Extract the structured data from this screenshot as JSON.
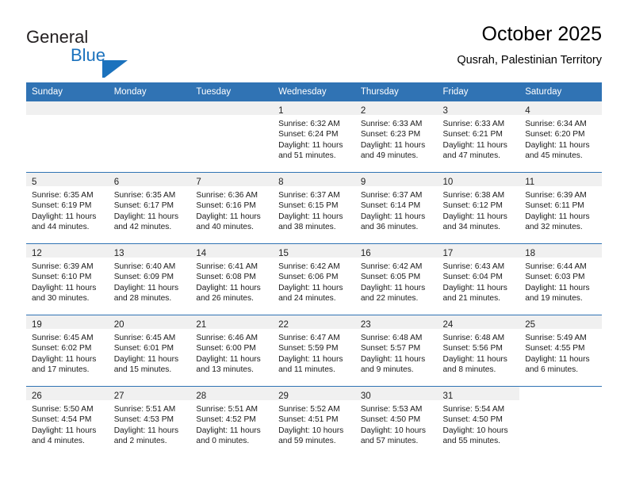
{
  "brand": {
    "name_part1": "General",
    "name_part2": "Blue",
    "logo_icon": "triangle-flag-icon",
    "accent_color": "#1b72bd"
  },
  "header": {
    "title": "October 2025",
    "location": "Qusrah, Palestinian Territory"
  },
  "theme": {
    "header_blue": "#3073b4",
    "band_gray": "#f0f0f0",
    "text_black": "#000000"
  },
  "weekday_headers": [
    "Sunday",
    "Monday",
    "Tuesday",
    "Wednesday",
    "Thursday",
    "Friday",
    "Saturday"
  ],
  "weeks": [
    [
      {
        "day": "",
        "sunrise": "",
        "sunset": "",
        "daylight_line1": "",
        "daylight_line2": "",
        "empty": true
      },
      {
        "day": "",
        "sunrise": "",
        "sunset": "",
        "daylight_line1": "",
        "daylight_line2": "",
        "empty": true
      },
      {
        "day": "",
        "sunrise": "",
        "sunset": "",
        "daylight_line1": "",
        "daylight_line2": "",
        "empty": true
      },
      {
        "day": "1",
        "sunrise": "Sunrise: 6:32 AM",
        "sunset": "Sunset: 6:24 PM",
        "daylight_line1": "Daylight: 11 hours",
        "daylight_line2": "and 51 minutes."
      },
      {
        "day": "2",
        "sunrise": "Sunrise: 6:33 AM",
        "sunset": "Sunset: 6:23 PM",
        "daylight_line1": "Daylight: 11 hours",
        "daylight_line2": "and 49 minutes."
      },
      {
        "day": "3",
        "sunrise": "Sunrise: 6:33 AM",
        "sunset": "Sunset: 6:21 PM",
        "daylight_line1": "Daylight: 11 hours",
        "daylight_line2": "and 47 minutes."
      },
      {
        "day": "4",
        "sunrise": "Sunrise: 6:34 AM",
        "sunset": "Sunset: 6:20 PM",
        "daylight_line1": "Daylight: 11 hours",
        "daylight_line2": "and 45 minutes."
      }
    ],
    [
      {
        "day": "5",
        "sunrise": "Sunrise: 6:35 AM",
        "sunset": "Sunset: 6:19 PM",
        "daylight_line1": "Daylight: 11 hours",
        "daylight_line2": "and 44 minutes."
      },
      {
        "day": "6",
        "sunrise": "Sunrise: 6:35 AM",
        "sunset": "Sunset: 6:17 PM",
        "daylight_line1": "Daylight: 11 hours",
        "daylight_line2": "and 42 minutes."
      },
      {
        "day": "7",
        "sunrise": "Sunrise: 6:36 AM",
        "sunset": "Sunset: 6:16 PM",
        "daylight_line1": "Daylight: 11 hours",
        "daylight_line2": "and 40 minutes."
      },
      {
        "day": "8",
        "sunrise": "Sunrise: 6:37 AM",
        "sunset": "Sunset: 6:15 PM",
        "daylight_line1": "Daylight: 11 hours",
        "daylight_line2": "and 38 minutes."
      },
      {
        "day": "9",
        "sunrise": "Sunrise: 6:37 AM",
        "sunset": "Sunset: 6:14 PM",
        "daylight_line1": "Daylight: 11 hours",
        "daylight_line2": "and 36 minutes."
      },
      {
        "day": "10",
        "sunrise": "Sunrise: 6:38 AM",
        "sunset": "Sunset: 6:12 PM",
        "daylight_line1": "Daylight: 11 hours",
        "daylight_line2": "and 34 minutes."
      },
      {
        "day": "11",
        "sunrise": "Sunrise: 6:39 AM",
        "sunset": "Sunset: 6:11 PM",
        "daylight_line1": "Daylight: 11 hours",
        "daylight_line2": "and 32 minutes."
      }
    ],
    [
      {
        "day": "12",
        "sunrise": "Sunrise: 6:39 AM",
        "sunset": "Sunset: 6:10 PM",
        "daylight_line1": "Daylight: 11 hours",
        "daylight_line2": "and 30 minutes."
      },
      {
        "day": "13",
        "sunrise": "Sunrise: 6:40 AM",
        "sunset": "Sunset: 6:09 PM",
        "daylight_line1": "Daylight: 11 hours",
        "daylight_line2": "and 28 minutes."
      },
      {
        "day": "14",
        "sunrise": "Sunrise: 6:41 AM",
        "sunset": "Sunset: 6:08 PM",
        "daylight_line1": "Daylight: 11 hours",
        "daylight_line2": "and 26 minutes."
      },
      {
        "day": "15",
        "sunrise": "Sunrise: 6:42 AM",
        "sunset": "Sunset: 6:06 PM",
        "daylight_line1": "Daylight: 11 hours",
        "daylight_line2": "and 24 minutes."
      },
      {
        "day": "16",
        "sunrise": "Sunrise: 6:42 AM",
        "sunset": "Sunset: 6:05 PM",
        "daylight_line1": "Daylight: 11 hours",
        "daylight_line2": "and 22 minutes."
      },
      {
        "day": "17",
        "sunrise": "Sunrise: 6:43 AM",
        "sunset": "Sunset: 6:04 PM",
        "daylight_line1": "Daylight: 11 hours",
        "daylight_line2": "and 21 minutes."
      },
      {
        "day": "18",
        "sunrise": "Sunrise: 6:44 AM",
        "sunset": "Sunset: 6:03 PM",
        "daylight_line1": "Daylight: 11 hours",
        "daylight_line2": "and 19 minutes."
      }
    ],
    [
      {
        "day": "19",
        "sunrise": "Sunrise: 6:45 AM",
        "sunset": "Sunset: 6:02 PM",
        "daylight_line1": "Daylight: 11 hours",
        "daylight_line2": "and 17 minutes."
      },
      {
        "day": "20",
        "sunrise": "Sunrise: 6:45 AM",
        "sunset": "Sunset: 6:01 PM",
        "daylight_line1": "Daylight: 11 hours",
        "daylight_line2": "and 15 minutes."
      },
      {
        "day": "21",
        "sunrise": "Sunrise: 6:46 AM",
        "sunset": "Sunset: 6:00 PM",
        "daylight_line1": "Daylight: 11 hours",
        "daylight_line2": "and 13 minutes."
      },
      {
        "day": "22",
        "sunrise": "Sunrise: 6:47 AM",
        "sunset": "Sunset: 5:59 PM",
        "daylight_line1": "Daylight: 11 hours",
        "daylight_line2": "and 11 minutes."
      },
      {
        "day": "23",
        "sunrise": "Sunrise: 6:48 AM",
        "sunset": "Sunset: 5:57 PM",
        "daylight_line1": "Daylight: 11 hours",
        "daylight_line2": "and 9 minutes."
      },
      {
        "day": "24",
        "sunrise": "Sunrise: 6:48 AM",
        "sunset": "Sunset: 5:56 PM",
        "daylight_line1": "Daylight: 11 hours",
        "daylight_line2": "and 8 minutes."
      },
      {
        "day": "25",
        "sunrise": "Sunrise: 5:49 AM",
        "sunset": "Sunset: 4:55 PM",
        "daylight_line1": "Daylight: 11 hours",
        "daylight_line2": "and 6 minutes."
      }
    ],
    [
      {
        "day": "26",
        "sunrise": "Sunrise: 5:50 AM",
        "sunset": "Sunset: 4:54 PM",
        "daylight_line1": "Daylight: 11 hours",
        "daylight_line2": "and 4 minutes."
      },
      {
        "day": "27",
        "sunrise": "Sunrise: 5:51 AM",
        "sunset": "Sunset: 4:53 PM",
        "daylight_line1": "Daylight: 11 hours",
        "daylight_line2": "and 2 minutes."
      },
      {
        "day": "28",
        "sunrise": "Sunrise: 5:51 AM",
        "sunset": "Sunset: 4:52 PM",
        "daylight_line1": "Daylight: 11 hours",
        "daylight_line2": "and 0 minutes."
      },
      {
        "day": "29",
        "sunrise": "Sunrise: 5:52 AM",
        "sunset": "Sunset: 4:51 PM",
        "daylight_line1": "Daylight: 10 hours",
        "daylight_line2": "and 59 minutes."
      },
      {
        "day": "30",
        "sunrise": "Sunrise: 5:53 AM",
        "sunset": "Sunset: 4:50 PM",
        "daylight_line1": "Daylight: 10 hours",
        "daylight_line2": "and 57 minutes."
      },
      {
        "day": "31",
        "sunrise": "Sunrise: 5:54 AM",
        "sunset": "Sunset: 4:50 PM",
        "daylight_line1": "Daylight: 10 hours",
        "daylight_line2": "and 55 minutes."
      },
      {
        "day": "",
        "sunrise": "",
        "sunset": "",
        "daylight_line1": "",
        "daylight_line2": "",
        "blank": true
      }
    ]
  ]
}
